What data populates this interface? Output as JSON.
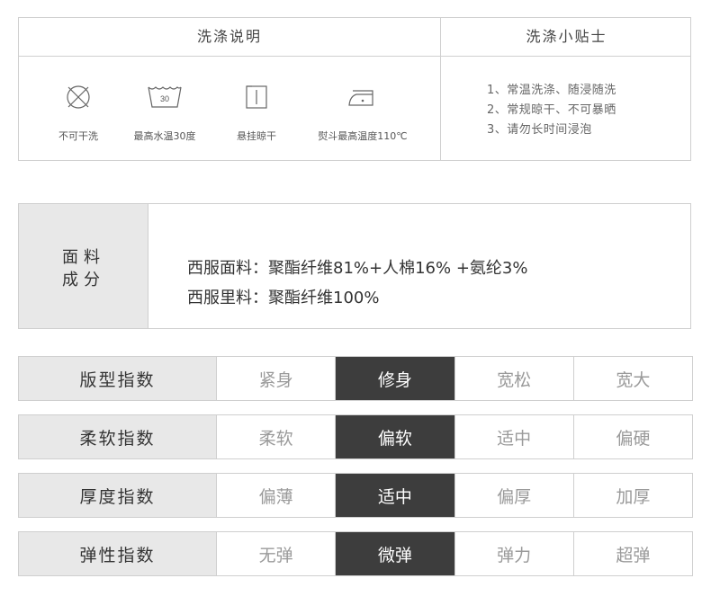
{
  "wash": {
    "title": "洗涤说明",
    "tips_title": "洗涤小贴士",
    "icons": [
      {
        "icon": "no-wash-icon",
        "label": "不可干洗"
      },
      {
        "icon": "wash-30-icon",
        "label": "最高水温30度",
        "temp": "30"
      },
      {
        "icon": "hang-dry-icon",
        "label": "悬挂晾干"
      },
      {
        "icon": "iron-icon",
        "label": "熨斗最高温度110℃"
      }
    ],
    "tips": [
      "1、常温洗涤、随浸随洗",
      "2、常规晾干、不可暴晒",
      "3、请勿长时间浸泡"
    ]
  },
  "fabric": {
    "head_line1": "面料",
    "head_line2": "成分",
    "lines": [
      "西服面料：聚酯纤维81%+人棉16% +氨纶3%",
      "西服里料：聚酯纤维100%"
    ]
  },
  "indices": [
    {
      "name": "版型指数",
      "options": [
        "紧身",
        "修身",
        "宽松",
        "宽大"
      ],
      "selected": 1
    },
    {
      "name": "柔软指数",
      "options": [
        "柔软",
        "偏软",
        "适中",
        "偏硬"
      ],
      "selected": 1
    },
    {
      "name": "厚度指数",
      "options": [
        "偏薄",
        "适中",
        "偏厚",
        "加厚"
      ],
      "selected": 1
    },
    {
      "name": "弹性指数",
      "options": [
        "无弹",
        "微弹",
        "弹力",
        "超弹"
      ],
      "selected": 1
    }
  ]
}
